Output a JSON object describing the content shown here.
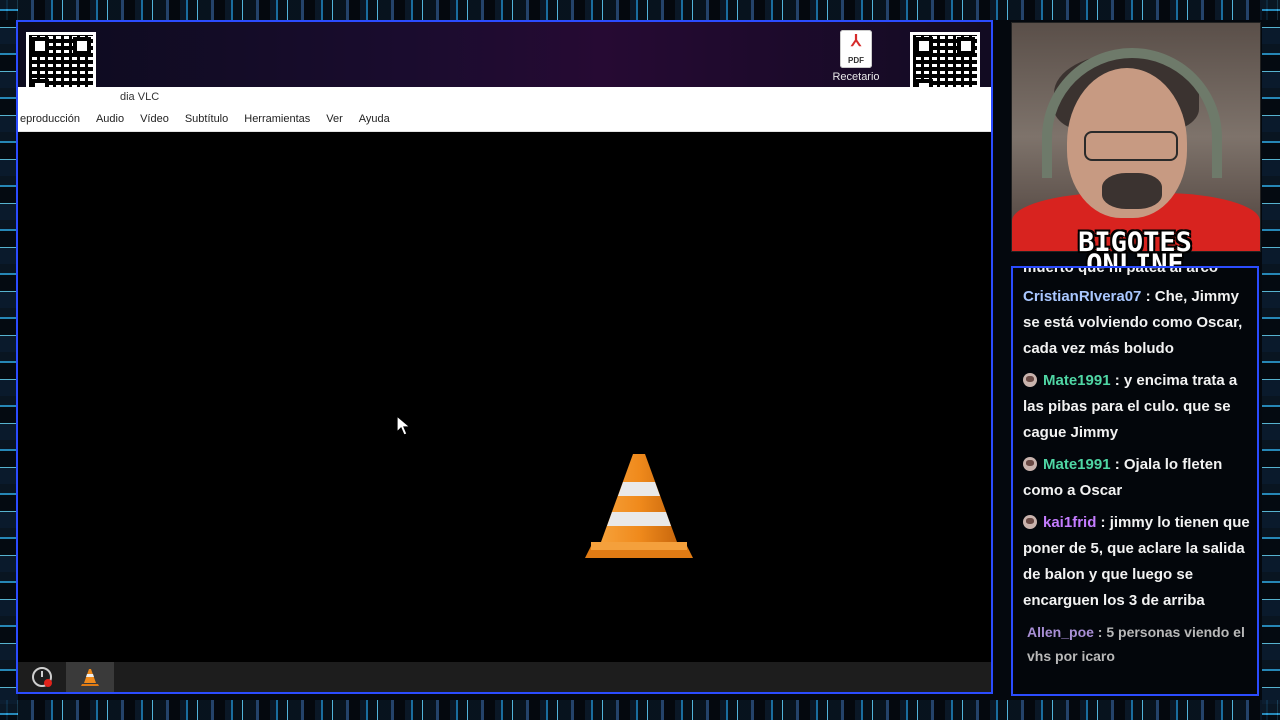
{
  "vlc": {
    "title": "Reproductor multimedia VLC",
    "title_visible": "dia VLC",
    "menu": [
      "eproducción",
      "Audio",
      "Vídeo",
      "Subtítulo",
      "Herramientas",
      "Ver",
      "Ayuda"
    ]
  },
  "desktop": {
    "pdf_label": "Recetario",
    "pdf_icon_text": "PDF"
  },
  "overlay": {
    "brand_line1": "BIGOTES",
    "brand_line2": "ONLINE"
  },
  "chat": {
    "partial_text": "muerto que ni patea al arco",
    "messages": [
      {
        "user": "CristianRIvera07",
        "user_color": "#a9c7ff",
        "text": ": Che, Jimmy se está volviendo como Oscar, cada vez más boludo",
        "badge": false
      },
      {
        "user": "Mate1991",
        "user_color": "#4fd6a4",
        "text": ": y encima trata a las pibas para el culo. que se cague Jimmy",
        "badge": true
      },
      {
        "user": "Mate1991",
        "user_color": "#4fd6a4",
        "text": ": Ojala lo fleten como a Oscar",
        "badge": true
      },
      {
        "user": "kai1frid",
        "user_color": "#c47cff",
        "text": ": jimmy lo tienen que poner de 5, que aclare la salida de balon y que luego se encarguen los 3 de arriba",
        "badge": true
      },
      {
        "user": "Allen_poe",
        "user_color": "#a98fd6",
        "text": ": 5 personas viendo el vhs por icaro",
        "badge": false,
        "dim": true
      }
    ]
  },
  "colors": {
    "frame_border": "#2b4cff",
    "vlc_orange": "#f08a1c"
  },
  "icons": [
    "qr-code-icon",
    "pdf-file-icon",
    "vlc-cone-icon",
    "mouse-cursor-icon",
    "screen-record-icon",
    "vlc-taskbar-icon"
  ]
}
